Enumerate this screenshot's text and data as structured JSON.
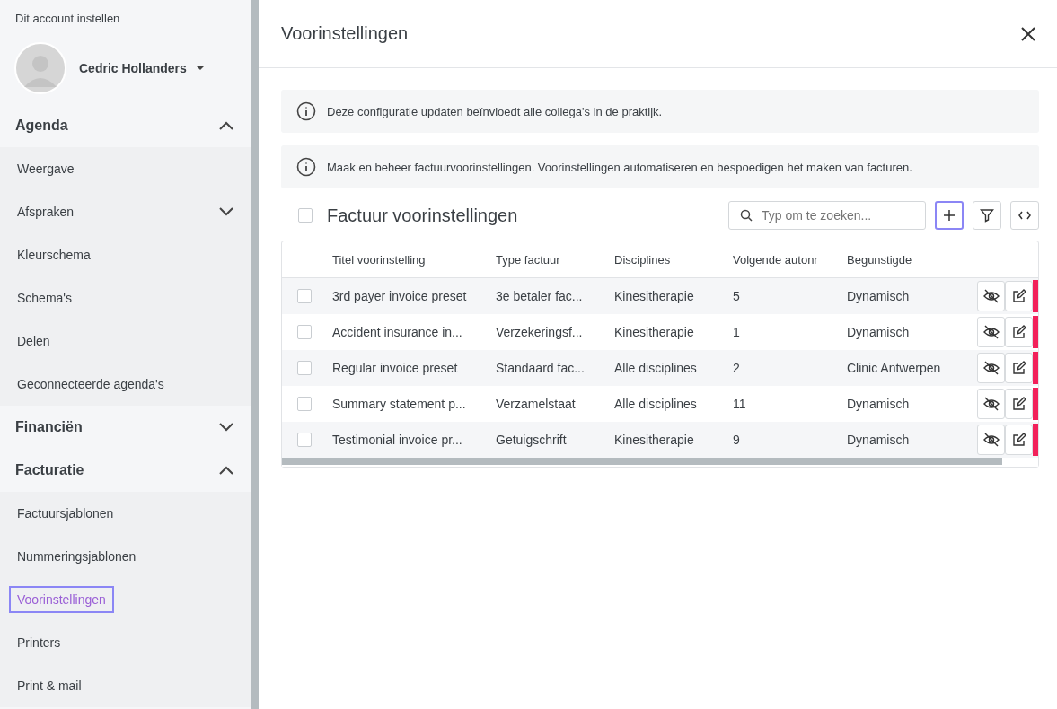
{
  "sidebar": {
    "account_label": "Dit account instellen",
    "user_name": "Cedric Hollanders",
    "sections": [
      {
        "title": "Agenda",
        "expanded": true,
        "items": [
          {
            "label": "Weergave",
            "selected": false,
            "has_children": false
          },
          {
            "label": "Afspraken",
            "selected": false,
            "has_children": true
          },
          {
            "label": "Kleurschema",
            "selected": false,
            "has_children": false
          },
          {
            "label": "Schema's",
            "selected": false,
            "has_children": false
          },
          {
            "label": "Delen",
            "selected": false,
            "has_children": false
          },
          {
            "label": "Geconnecteerde agenda's",
            "selected": false,
            "has_children": false
          }
        ]
      },
      {
        "title": "Financiën",
        "expanded": false
      },
      {
        "title": "Facturatie",
        "expanded": true,
        "items": [
          {
            "label": "Factuursjablonen",
            "selected": false,
            "has_children": false
          },
          {
            "label": "Nummeringsjablonen",
            "selected": false,
            "has_children": false
          },
          {
            "label": "Voorinstellingen",
            "selected": true,
            "has_children": false
          },
          {
            "label": "Printers",
            "selected": false,
            "has_children": false
          },
          {
            "label": "Print & mail",
            "selected": false,
            "has_children": false
          }
        ]
      }
    ]
  },
  "panel": {
    "title": "Voorinstellingen",
    "notices": [
      "Deze configuratie updaten beïnvloedt alle collega's in de praktijk.",
      "Maak en beheer factuurvoorinstellingen. Voorinstellingen automatiseren en bespoedigen het maken van facturen."
    ],
    "table_title": "Factuur voorinstellingen",
    "all_checked": false,
    "search": {
      "placeholder": "Typ om te zoeken..."
    },
    "columns": [
      "Titel voorinstelling",
      "Type factuur",
      "Disciplines",
      "Volgende autonr",
      "Begunstigde"
    ],
    "rows": [
      {
        "cells": [
          "3rd payer invoice preset",
          "3e betaler fac...",
          "Kinesitherapie",
          "5",
          "Dynamisch"
        ],
        "checked": false
      },
      {
        "cells": [
          "Accident insurance in...",
          "Verzekeringsf...",
          "Kinesitherapie",
          "1",
          "Dynamisch"
        ],
        "checked": false
      },
      {
        "cells": [
          "Regular invoice preset",
          "Standaard fac...",
          "Alle disciplines",
          "2",
          "Clinic Antwerpen"
        ],
        "checked": false
      },
      {
        "cells": [
          "Summary statement p...",
          "Verzamelstaat",
          "Alle disciplines",
          "11",
          "Dynamisch"
        ],
        "checked": false
      },
      {
        "cells": [
          "Testimonial invoice pr...",
          "Getuigschrift",
          "Kinesitherapie",
          "9",
          "Dynamisch"
        ],
        "checked": false
      }
    ]
  }
}
